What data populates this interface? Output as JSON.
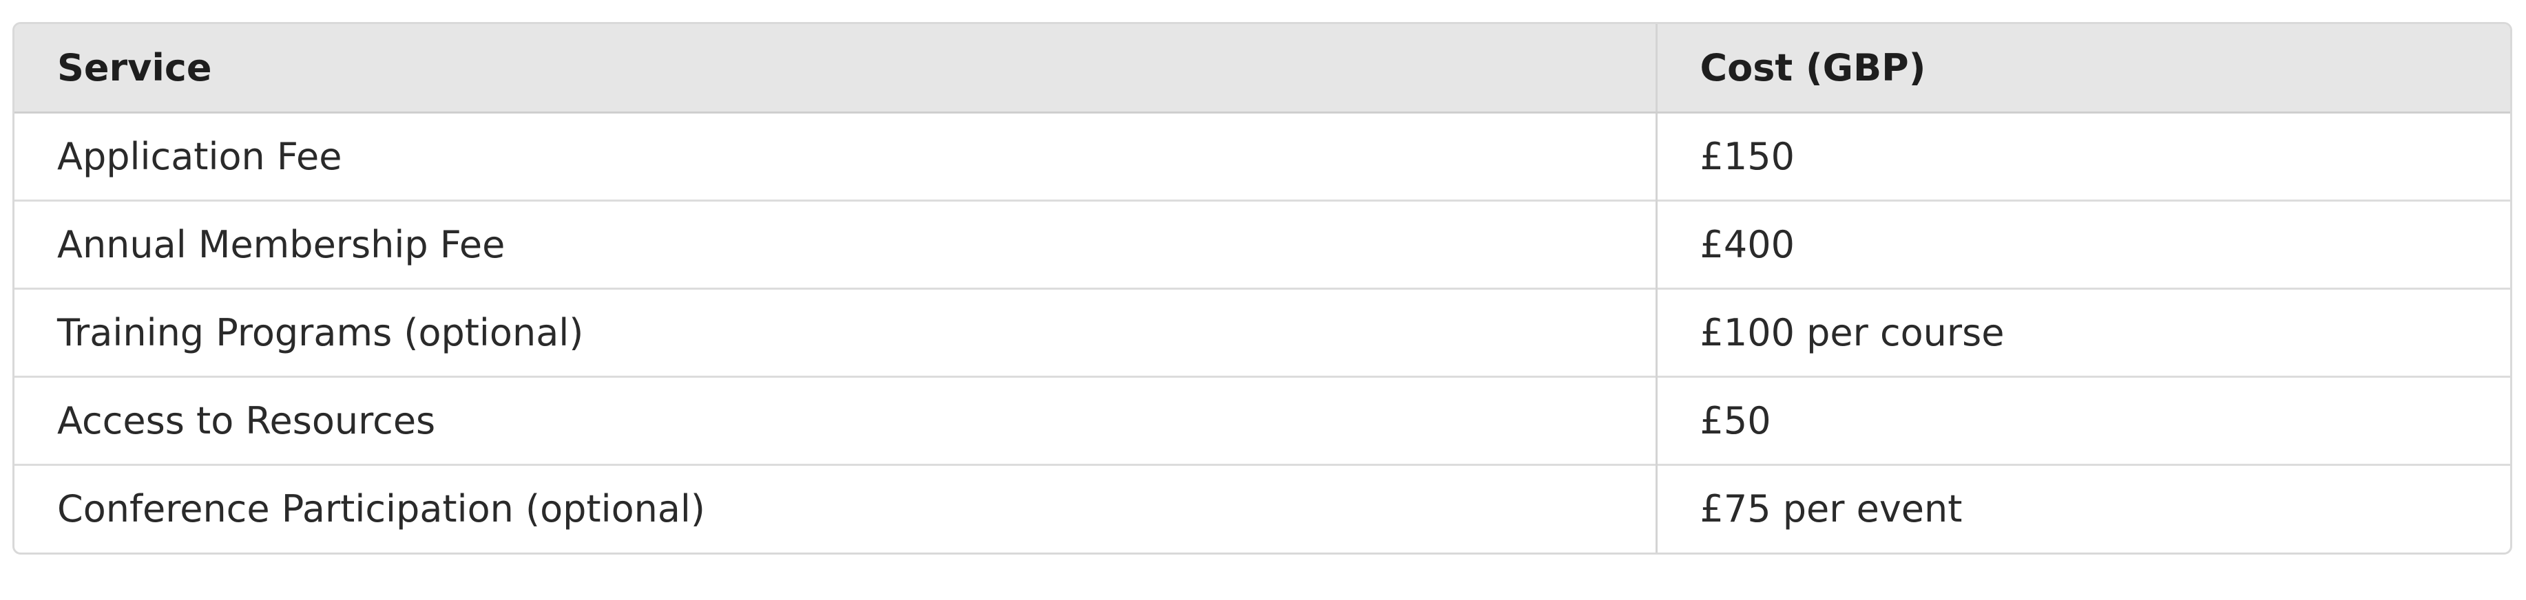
{
  "table": {
    "headers": [
      "Service",
      "Cost (GBP)"
    ],
    "rows": [
      [
        "Application Fee",
        "£150"
      ],
      [
        "Annual Membership Fee",
        "£400"
      ],
      [
        "Training Programs (optional)",
        "£100 per course"
      ],
      [
        "Access to Resources",
        "£50"
      ],
      [
        "Conference Participation (optional)",
        "£75 per event"
      ]
    ]
  }
}
